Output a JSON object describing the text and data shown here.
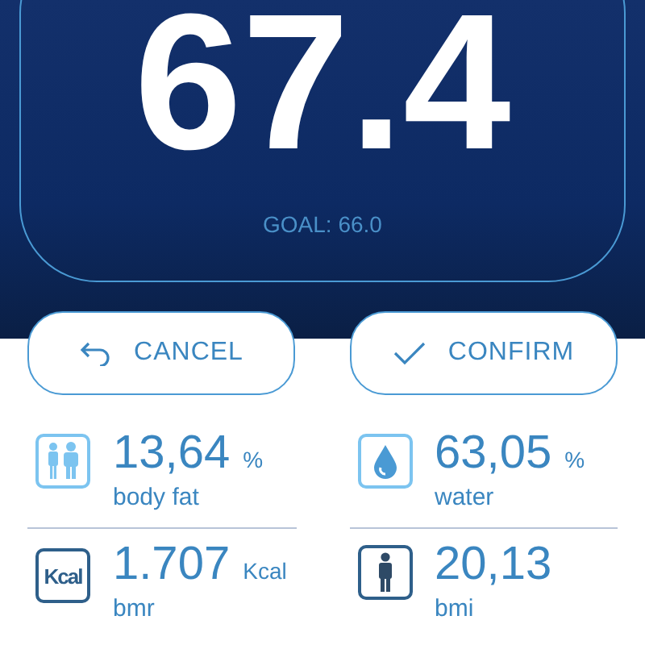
{
  "reading": {
    "value": "67.4",
    "goal": "GOAL: 66.0"
  },
  "buttons": [
    {
      "kind": "cancel",
      "label": "CANCEL"
    },
    {
      "kind": "confirm",
      "label": "CONFIRM"
    }
  ],
  "metrics": [
    {
      "kind": "bodyfat",
      "value": "13,64",
      "unit": "%",
      "label": "body fat"
    },
    {
      "kind": "water",
      "value": "63,05",
      "unit": "%",
      "label": "water"
    },
    {
      "kind": "kcal",
      "badge": "Kcal",
      "value": "1.707",
      "unit": "Kcal",
      "label": "bmr"
    },
    {
      "kind": "bmi",
      "value": "20,13",
      "label": "bmi"
    }
  ]
}
